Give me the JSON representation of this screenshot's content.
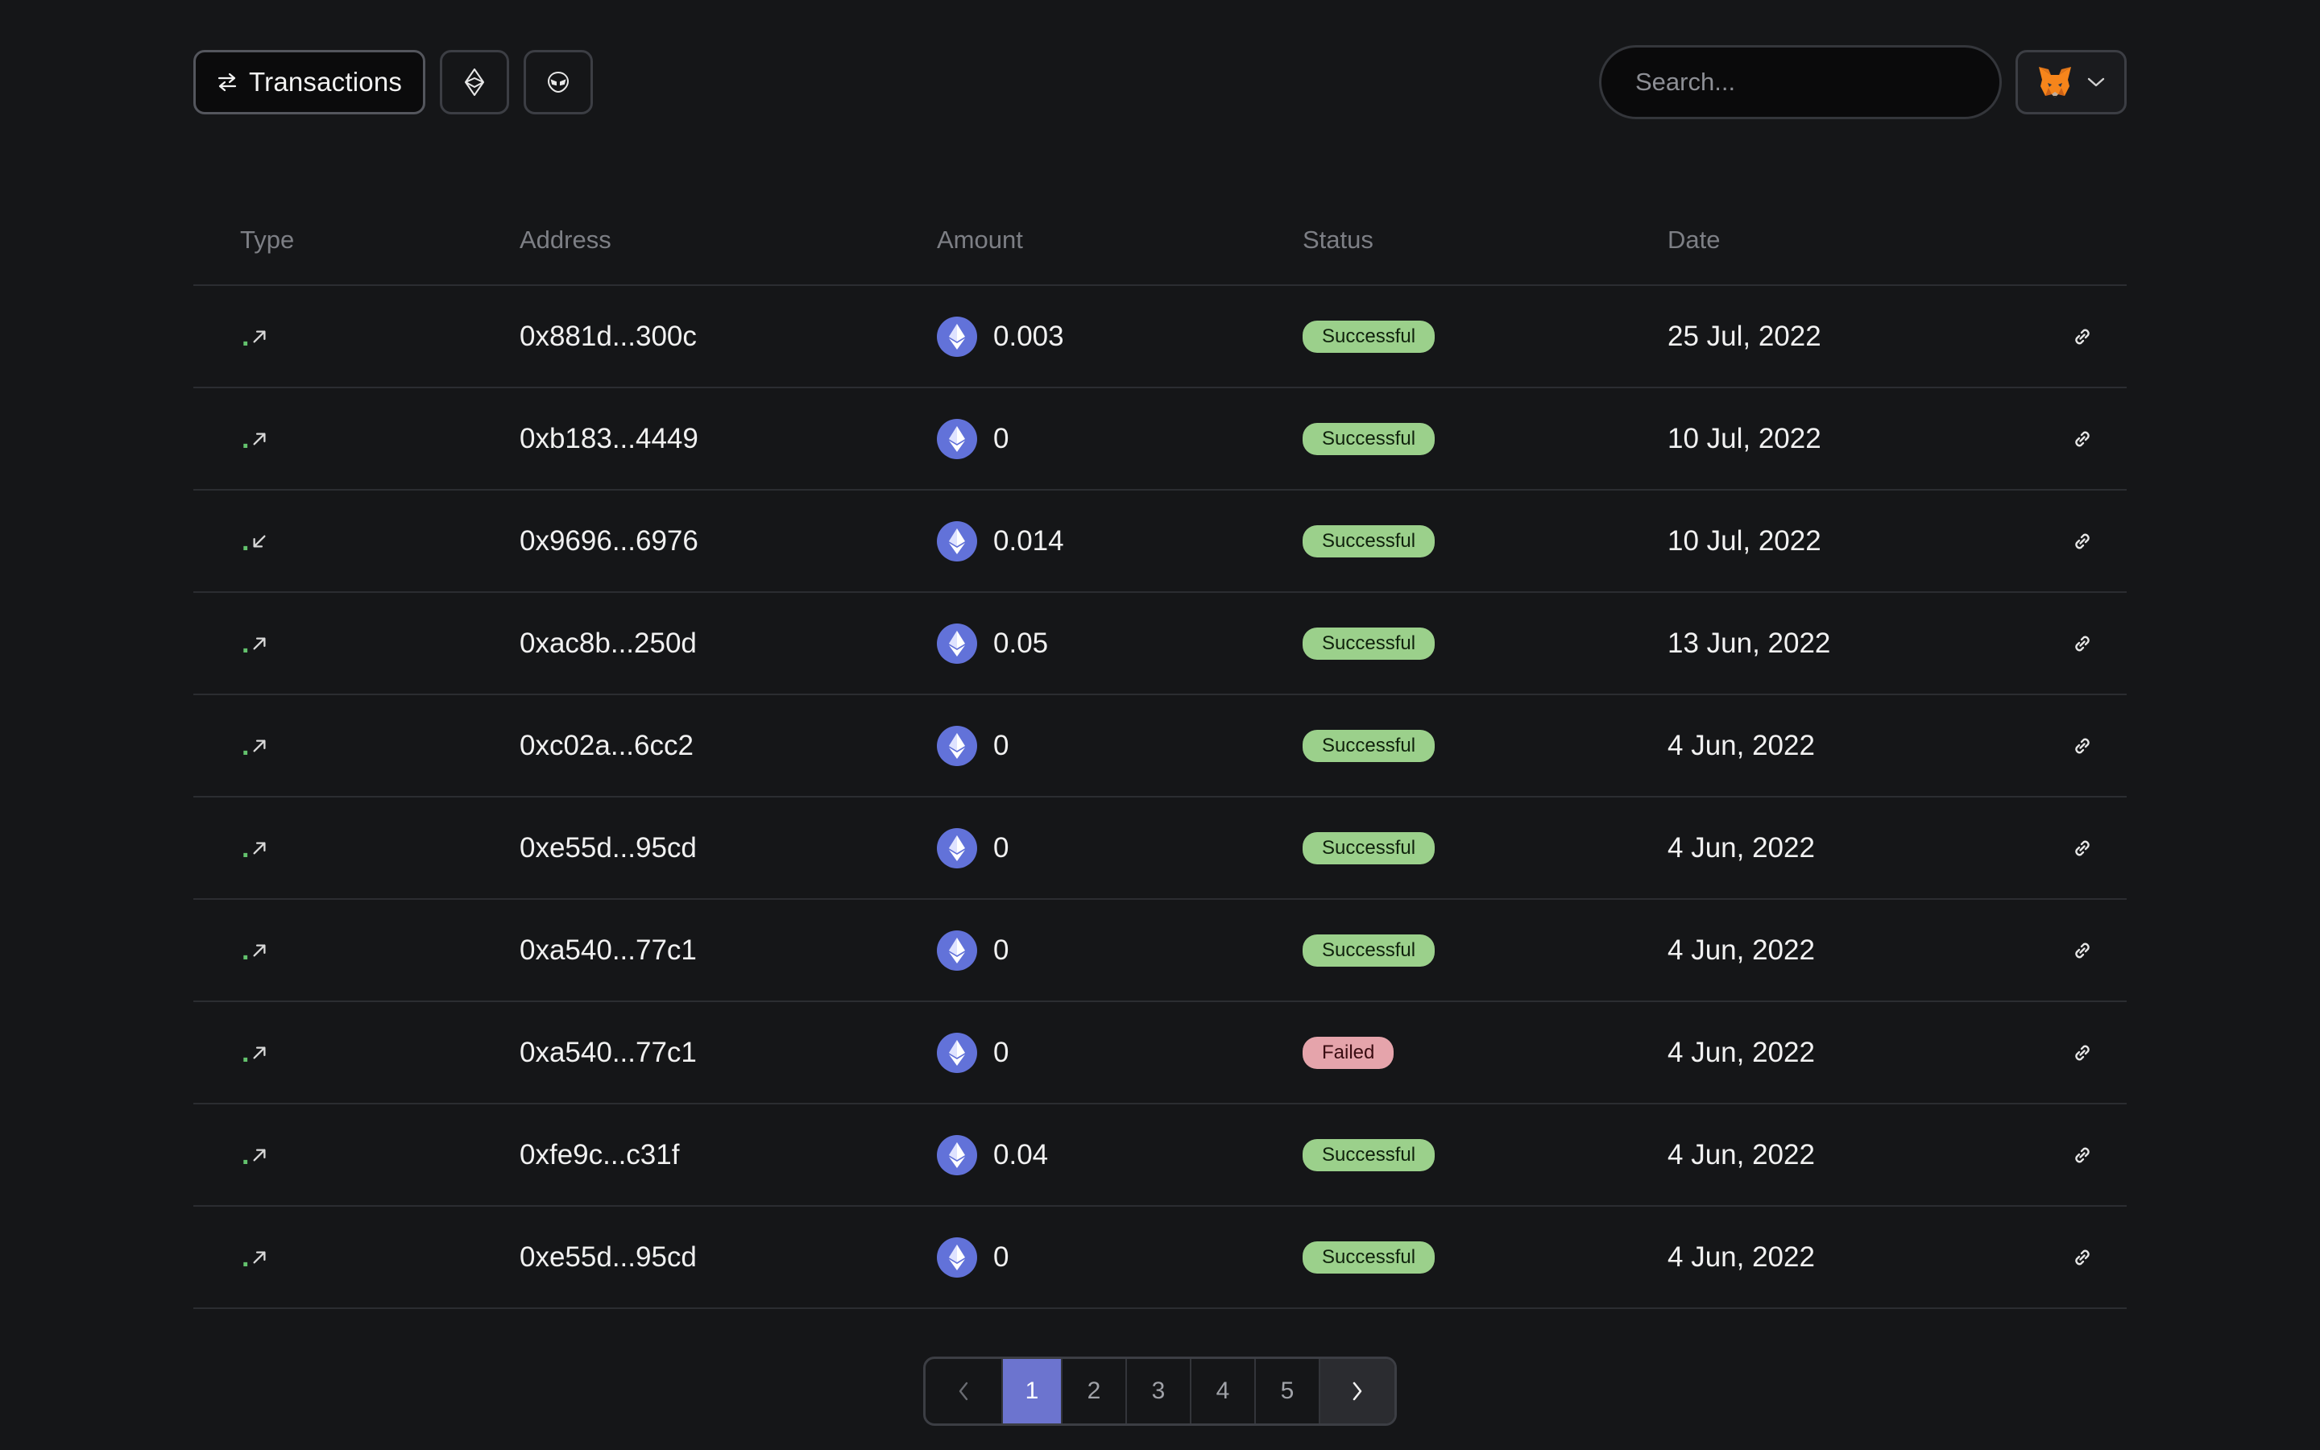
{
  "toolbar": {
    "transactions_label": "Transactions",
    "search_placeholder": "Search..."
  },
  "table": {
    "headers": [
      "Type",
      "Address",
      "Amount",
      "Status",
      "Date"
    ],
    "rows": [
      {
        "type": "outgoing",
        "address": "0x881d...300c",
        "amount": "0.003",
        "status": "Successful",
        "date": "25 Jul, 2022"
      },
      {
        "type": "outgoing",
        "address": "0xb183...4449",
        "amount": "0",
        "status": "Successful",
        "date": "10 Jul, 2022"
      },
      {
        "type": "incoming",
        "address": "0x9696...6976",
        "amount": "0.014",
        "status": "Successful",
        "date": "10 Jul, 2022"
      },
      {
        "type": "outgoing",
        "address": "0xac8b...250d",
        "amount": "0.05",
        "status": "Successful",
        "date": "13 Jun, 2022"
      },
      {
        "type": "outgoing",
        "address": "0xc02a...6cc2",
        "amount": "0",
        "status": "Successful",
        "date": "4 Jun, 2022"
      },
      {
        "type": "outgoing",
        "address": "0xe55d...95cd",
        "amount": "0",
        "status": "Successful",
        "date": "4 Jun, 2022"
      },
      {
        "type": "outgoing",
        "address": "0xa540...77c1",
        "amount": "0",
        "status": "Successful",
        "date": "4 Jun, 2022"
      },
      {
        "type": "outgoing",
        "address": "0xa540...77c1",
        "amount": "0",
        "status": "Failed",
        "date": "4 Jun, 2022"
      },
      {
        "type": "outgoing",
        "address": "0xfe9c...c31f",
        "amount": "0.04",
        "status": "Successful",
        "date": "4 Jun, 2022"
      },
      {
        "type": "outgoing",
        "address": "0xe55d...95cd",
        "amount": "0",
        "status": "Successful",
        "date": "4 Jun, 2022"
      }
    ]
  },
  "pagination": {
    "pages": [
      "1",
      "2",
      "3",
      "4",
      "5"
    ],
    "current": "1"
  },
  "colors": {
    "success": "#9bd08b",
    "failed": "#e5a4ab",
    "accent": "#6c74cf",
    "eth": "#6272d9",
    "type_dot": "#63c26d"
  },
  "icons": {
    "transactions_button": "arrows-left-right-icon",
    "eth_filter": "ethereum-icon",
    "alien_filter": "alien-icon",
    "wallet": "metamask-fox-icon",
    "row_link": "link-icon",
    "type_out": "arrow-up-right-icon",
    "type_in": "arrow-down-left-icon"
  }
}
